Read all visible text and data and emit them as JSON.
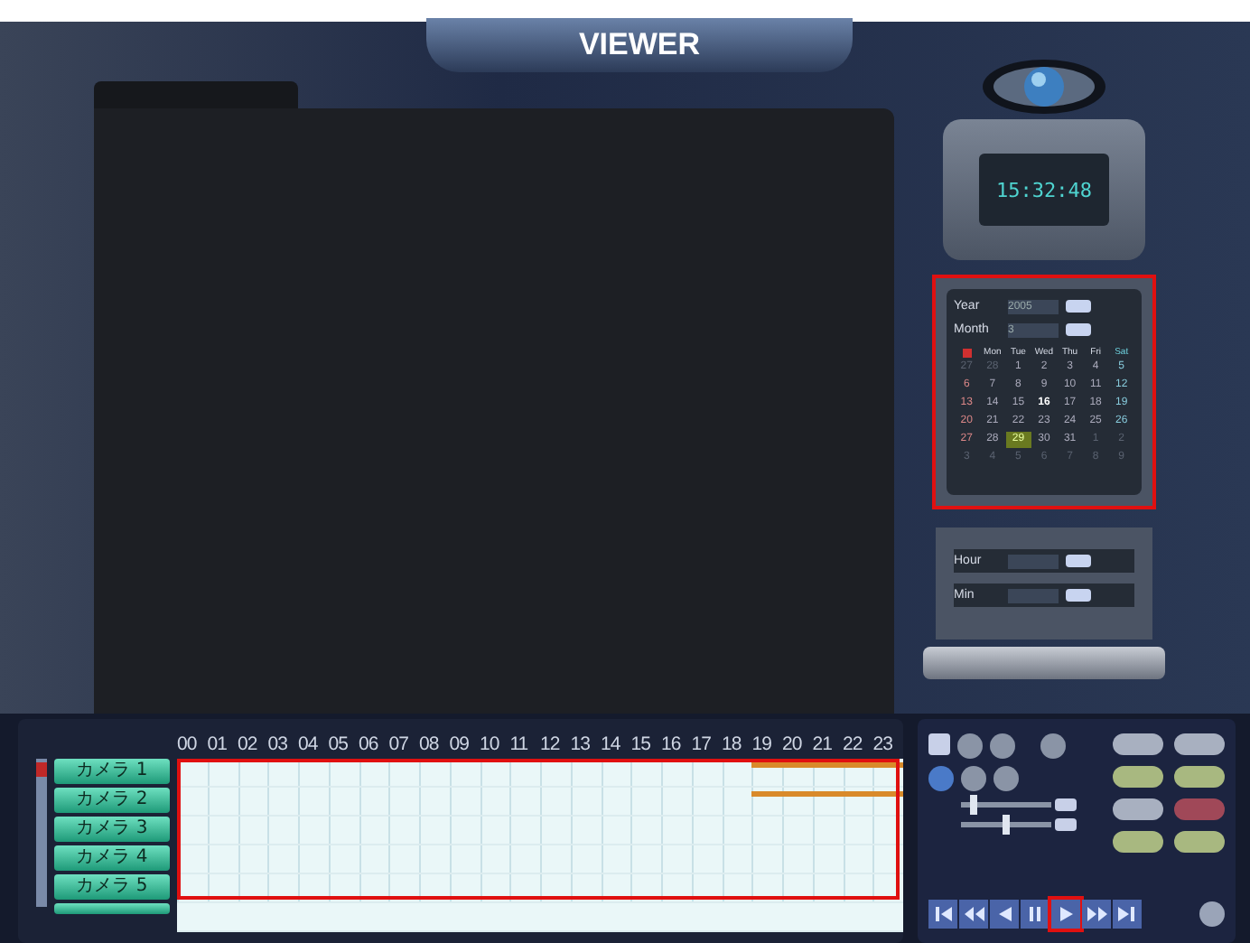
{
  "title": "VIEWER",
  "clock": {
    "time": "15:32:48"
  },
  "calendar": {
    "highlighted": true,
    "year_label": "Year",
    "year": "2005",
    "month_label": "Month",
    "month": "3",
    "weekdays": [
      {
        "kind": "sun"
      },
      {
        "kind": "day",
        "text": "Mon"
      },
      {
        "kind": "day",
        "text": "Tue"
      },
      {
        "kind": "day",
        "text": "Wed"
      },
      {
        "kind": "day",
        "text": "Thu"
      },
      {
        "kind": "day",
        "text": "Fri"
      },
      {
        "kind": "sat",
        "text": "Sat"
      }
    ],
    "days": [
      {
        "text": "27",
        "muted": true,
        "today": false,
        "selected": false
      },
      {
        "text": "28",
        "muted": true,
        "today": false,
        "selected": false
      },
      {
        "text": "1",
        "muted": false,
        "today": false,
        "selected": false
      },
      {
        "text": "2",
        "muted": false,
        "today": false,
        "selected": false
      },
      {
        "text": "3",
        "muted": false,
        "today": false,
        "selected": false
      },
      {
        "text": "4",
        "muted": false,
        "today": false,
        "selected": false
      },
      {
        "text": "5",
        "muted": false,
        "today": false,
        "selected": false
      },
      {
        "text": "6",
        "muted": false,
        "today": false,
        "selected": false
      },
      {
        "text": "7",
        "muted": false,
        "today": false,
        "selected": false
      },
      {
        "text": "8",
        "muted": false,
        "today": false,
        "selected": false
      },
      {
        "text": "9",
        "muted": false,
        "today": false,
        "selected": false
      },
      {
        "text": "10",
        "muted": false,
        "today": false,
        "selected": false
      },
      {
        "text": "11",
        "muted": false,
        "today": false,
        "selected": false
      },
      {
        "text": "12",
        "muted": false,
        "today": false,
        "selected": false
      },
      {
        "text": "13",
        "muted": false,
        "today": false,
        "selected": false
      },
      {
        "text": "14",
        "muted": false,
        "today": false,
        "selected": false
      },
      {
        "text": "15",
        "muted": false,
        "today": false,
        "selected": false
      },
      {
        "text": "16",
        "muted": false,
        "today": true,
        "selected": false
      },
      {
        "text": "17",
        "muted": false,
        "today": false,
        "selected": false
      },
      {
        "text": "18",
        "muted": false,
        "today": false,
        "selected": false
      },
      {
        "text": "19",
        "muted": false,
        "today": false,
        "selected": false
      },
      {
        "text": "20",
        "muted": false,
        "today": false,
        "selected": false
      },
      {
        "text": "21",
        "muted": false,
        "today": false,
        "selected": false
      },
      {
        "text": "22",
        "muted": false,
        "today": false,
        "selected": false
      },
      {
        "text": "23",
        "muted": false,
        "today": false,
        "selected": false
      },
      {
        "text": "24",
        "muted": false,
        "today": false,
        "selected": false
      },
      {
        "text": "25",
        "muted": false,
        "today": false,
        "selected": false
      },
      {
        "text": "26",
        "muted": false,
        "today": false,
        "selected": false
      },
      {
        "text": "27",
        "muted": false,
        "today": false,
        "selected": false
      },
      {
        "text": "28",
        "muted": false,
        "today": false,
        "selected": false
      },
      {
        "text": "29",
        "muted": false,
        "today": false,
        "selected": true
      },
      {
        "text": "30",
        "muted": false,
        "today": false,
        "selected": false
      },
      {
        "text": "31",
        "muted": false,
        "today": false,
        "selected": false
      },
      {
        "text": "1",
        "muted": true,
        "today": false,
        "selected": false
      },
      {
        "text": "2",
        "muted": true,
        "today": false,
        "selected": false
      },
      {
        "text": "3",
        "muted": true,
        "today": false,
        "selected": false
      },
      {
        "text": "4",
        "muted": true,
        "today": false,
        "selected": false
      },
      {
        "text": "5",
        "muted": true,
        "today": false,
        "selected": false
      },
      {
        "text": "6",
        "muted": true,
        "today": false,
        "selected": false
      },
      {
        "text": "7",
        "muted": true,
        "today": false,
        "selected": false
      },
      {
        "text": "8",
        "muted": true,
        "today": false,
        "selected": false
      },
      {
        "text": "9",
        "muted": true,
        "today": false,
        "selected": false
      }
    ]
  },
  "time_picker": {
    "hour_label": "Hour",
    "min_label": "Min"
  },
  "timeline": {
    "highlighted": true,
    "hours": [
      "00",
      "01",
      "02",
      "03",
      "04",
      "05",
      "06",
      "07",
      "08",
      "09",
      "10",
      "11",
      "12",
      "13",
      "14",
      "15",
      "16",
      "17",
      "18",
      "19",
      "20",
      "21",
      "22",
      "23"
    ],
    "cameras": [
      {
        "label": "カメラ 1",
        "recording": {
          "level": 0.21
        }
      },
      {
        "label": "カメラ 2",
        "recording": {
          "level": 0.21
        }
      },
      {
        "label": "カメラ 3"
      },
      {
        "label": "カメラ 4"
      },
      {
        "label": "カメラ 5"
      }
    ]
  },
  "sliders": [
    {
      "level": 0.1
    },
    {
      "level": 0.45
    }
  ],
  "playback": [
    {
      "kind": "first",
      "highlighted": false
    },
    {
      "kind": "rewind",
      "highlighted": false
    },
    {
      "kind": "back",
      "highlighted": false
    },
    {
      "kind": "pause",
      "highlighted": false
    },
    {
      "kind": "play",
      "highlighted": true
    },
    {
      "kind": "forward",
      "highlighted": false
    },
    {
      "kind": "last",
      "highlighted": false
    }
  ]
}
